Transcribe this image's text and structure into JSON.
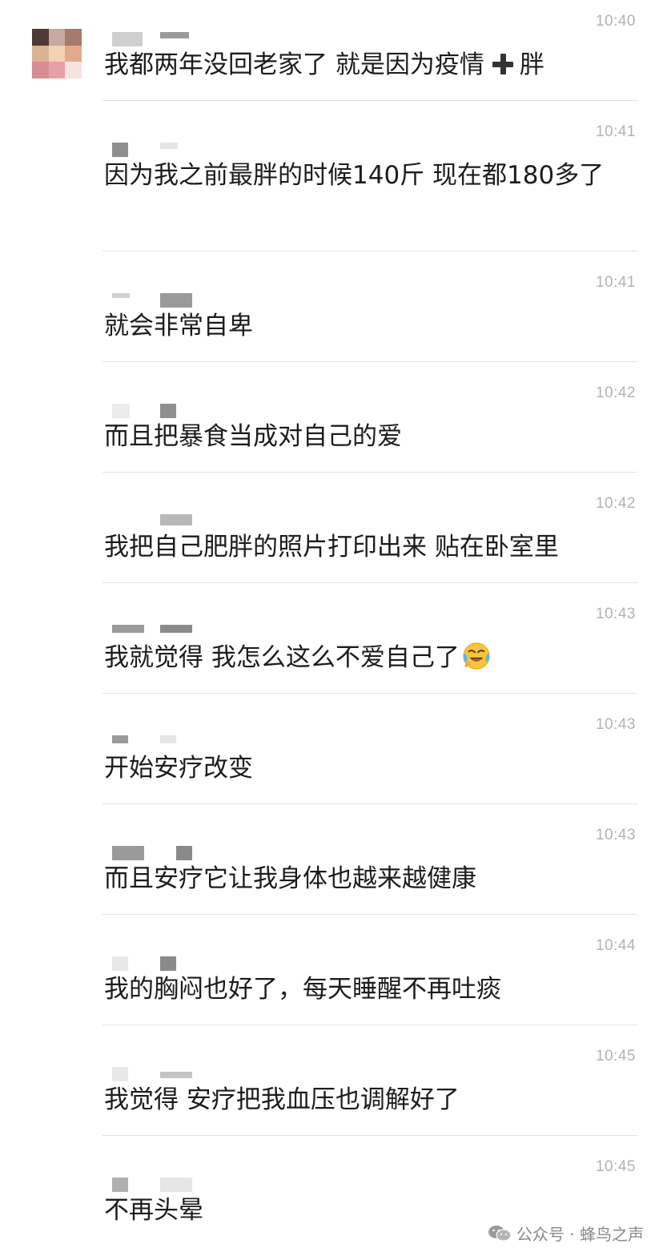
{
  "messages": [
    {
      "time": "10:40",
      "text_a": "我都两年没回老家了 就是因为疫情",
      "text_b": "胖"
    },
    {
      "time": "10:41",
      "text": "因为我之前最胖的时候140斤 现在都180多了"
    },
    {
      "time": "10:41",
      "text": "就会非常自卑"
    },
    {
      "time": "10:42",
      "text": "而且把暴食当成对自己的爱"
    },
    {
      "time": "10:42",
      "text": "我把自己肥胖的照片打印出来 贴在卧室里"
    },
    {
      "time": "10:43",
      "text": "我就觉得 我怎么这么不爱自己了"
    },
    {
      "time": "10:43",
      "text": "开始安疗改变"
    },
    {
      "time": "10:43",
      "text": "而且安疗它让我身体也越来越健康"
    },
    {
      "time": "10:44",
      "text": "我的胸闷也好了，每天睡醒不再吐痰"
    },
    {
      "time": "10:45",
      "text": "我觉得 安疗把我血压也调解好了"
    },
    {
      "time": "10:45",
      "text": "不再头晕"
    }
  ],
  "icons": {
    "plus": "heavy-plus-icon",
    "emoji": "crying-laughing-emoji-icon",
    "watermark": "wechat-official-account-icon"
  },
  "watermark": {
    "text": "公众号 · 蜂鸟之声"
  },
  "colors": {
    "time": "#b3b3b3",
    "divider": "#e4e4e4",
    "text": "#1c1c1c"
  }
}
